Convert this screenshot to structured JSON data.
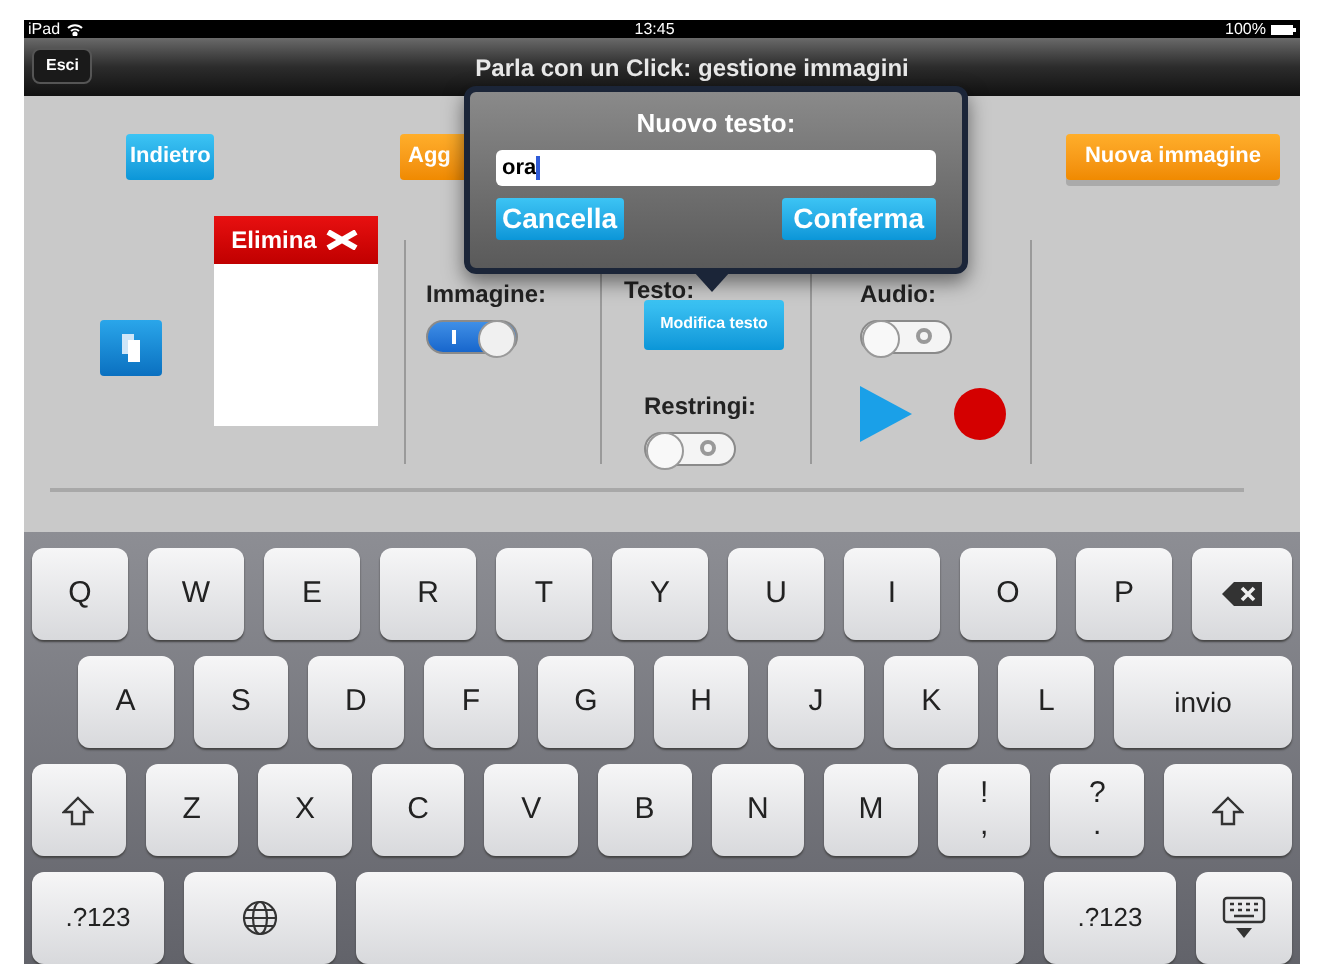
{
  "status_bar": {
    "device": "iPad",
    "time": "13:45",
    "battery": "100%"
  },
  "nav_bar": {
    "back_button": "Esci",
    "title": "Parla con un Click: gestione immagini"
  },
  "toolbar": {
    "back": "Indietro",
    "add": "Agg",
    "new_image": "Nuova immagine"
  },
  "image_panel": {
    "delete_label": "Elimina"
  },
  "image_column": {
    "label": "Immagine:",
    "toggle_on": true
  },
  "text_column": {
    "label": "Testo:",
    "edit_button": "Modifica testo",
    "shrink_label": "Restringi:",
    "shrink_on": false
  },
  "audio_column": {
    "label": "Audio:",
    "toggle_on": false
  },
  "popover": {
    "title": "Nuovo testo:",
    "value": "ora",
    "cancel": "Cancella",
    "confirm": "Conferma"
  },
  "keyboard": {
    "rows": [
      [
        {
          "kind": "char",
          "label": "Q"
        },
        {
          "kind": "char",
          "label": "W"
        },
        {
          "kind": "char",
          "label": "E"
        },
        {
          "kind": "char",
          "label": "R"
        },
        {
          "kind": "char",
          "label": "T"
        },
        {
          "kind": "char",
          "label": "Y"
        },
        {
          "kind": "char",
          "label": "U"
        },
        {
          "kind": "char",
          "label": "I"
        },
        {
          "kind": "char",
          "label": "O"
        },
        {
          "kind": "char",
          "label": "P"
        },
        {
          "kind": "backspace"
        }
      ],
      [
        {
          "kind": "char",
          "label": "A"
        },
        {
          "kind": "char",
          "label": "S"
        },
        {
          "kind": "char",
          "label": "D"
        },
        {
          "kind": "char",
          "label": "F"
        },
        {
          "kind": "char",
          "label": "G"
        },
        {
          "kind": "char",
          "label": "H"
        },
        {
          "kind": "char",
          "label": "J"
        },
        {
          "kind": "char",
          "label": "K"
        },
        {
          "kind": "char",
          "label": "L"
        },
        {
          "kind": "return",
          "label": "invio"
        }
      ],
      [
        {
          "kind": "shift"
        },
        {
          "kind": "char",
          "label": "Z"
        },
        {
          "kind": "char",
          "label": "X"
        },
        {
          "kind": "char",
          "label": "C"
        },
        {
          "kind": "char",
          "label": "V"
        },
        {
          "kind": "char",
          "label": "B"
        },
        {
          "kind": "char",
          "label": "N"
        },
        {
          "kind": "char",
          "label": "M"
        },
        {
          "kind": "dual",
          "label": "!",
          "sub": ","
        },
        {
          "kind": "dual",
          "label": "?",
          "sub": "."
        },
        {
          "kind": "shift"
        }
      ]
    ],
    "bottom_row": {
      "numbers_key_left": ".?123",
      "numbers_key_right": ".?123"
    }
  }
}
